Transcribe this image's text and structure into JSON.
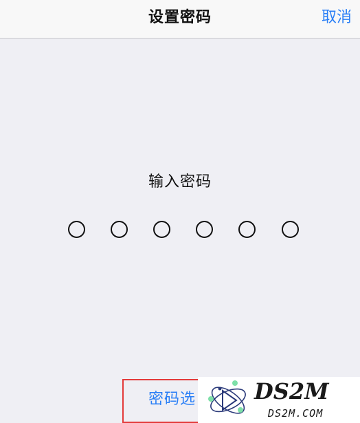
{
  "nav": {
    "title": "设置密码",
    "cancel_label": "取消"
  },
  "prompt": "输入密码",
  "passcode": {
    "length": 6,
    "entered": 0
  },
  "options_label": "密码选",
  "watermark": {
    "logo_text": "DS2M",
    "domain_text": "DS2M.COM"
  },
  "colors": {
    "accent": "#2a7ff6",
    "highlight_box": "#e33a3a",
    "background": "#efeff4",
    "nav_background": "#f8f8f8"
  }
}
